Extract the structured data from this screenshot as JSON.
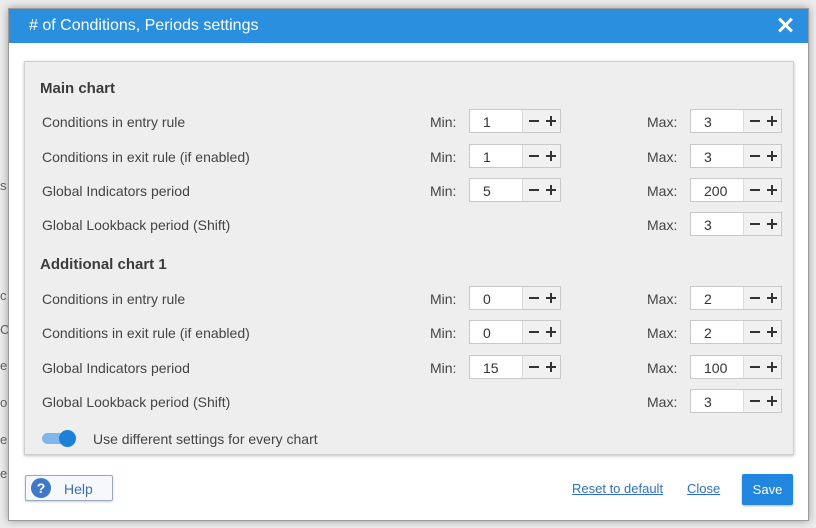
{
  "dialog": {
    "title": "# of Conditions, Periods settings"
  },
  "labels": {
    "min": "Min:",
    "max": "Max:"
  },
  "main_chart": {
    "title": "Main chart",
    "rows": [
      {
        "label": "Conditions in entry rule",
        "min": "1",
        "max": "3"
      },
      {
        "label": "Conditions in exit rule (if enabled)",
        "min": "1",
        "max": "3"
      },
      {
        "label": "Global Indicators period",
        "min": "5",
        "max": "200"
      },
      {
        "label": "Global Lookback period (Shift)",
        "max": "3"
      }
    ]
  },
  "additional_chart": {
    "title": "Additional chart 1",
    "rows": [
      {
        "label": "Conditions in entry rule",
        "min": "0",
        "max": "2"
      },
      {
        "label": "Conditions in exit rule (if enabled)",
        "min": "0",
        "max": "2"
      },
      {
        "label": "Global Indicators period",
        "min": "15",
        "max": "100"
      },
      {
        "label": "Global Lookback period (Shift)",
        "max": "3"
      }
    ]
  },
  "toggle": {
    "label": "Use different settings for every chart",
    "on": true
  },
  "footer": {
    "help": "Help",
    "reset": "Reset to default",
    "close": "Close",
    "save": "Save"
  },
  "colors": {
    "accent": "#2b8fe0",
    "save_button": "#2186df",
    "link": "#2f6fc4"
  }
}
